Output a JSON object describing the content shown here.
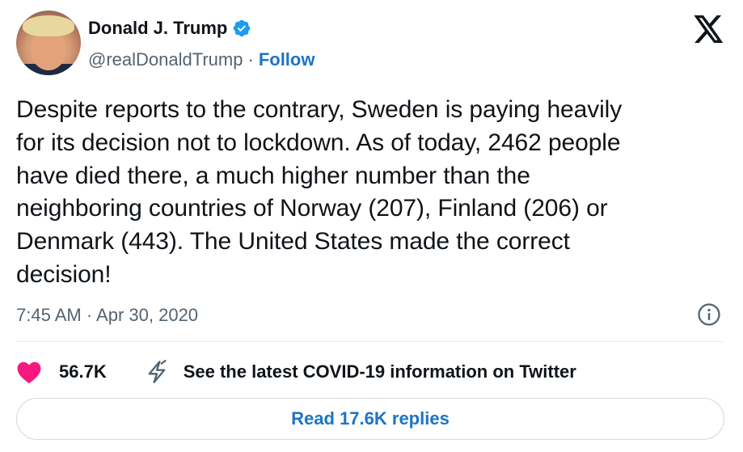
{
  "author": {
    "display_name": "Donald J. Trump",
    "handle": "@realDonaldTrump",
    "separator": "·",
    "follow_label": "Follow",
    "verified": true,
    "verified_color": "#1d9bf0"
  },
  "brand": {
    "logo": "x-logo-icon"
  },
  "tweet": {
    "text": "Despite reports to the contrary, Sweden is paying heavily\nfor its decision not to lockdown. As of today, 2462 people\nhave died there, a much higher number than the\nneighboring countries of Norway (207), Finland (206) or\nDenmark (443). The United States made the correct\ndecision!",
    "timestamp": "7:45 AM · Apr 30, 2020"
  },
  "actions": {
    "like_count": "56.7K",
    "like_color": "#f91880",
    "covid_label": "See the latest COVID-19 information on Twitter",
    "read_replies_label": "Read 17.6K replies"
  },
  "colors": {
    "link": "#1d74c4",
    "muted": "#536471",
    "text": "#0f1419"
  }
}
